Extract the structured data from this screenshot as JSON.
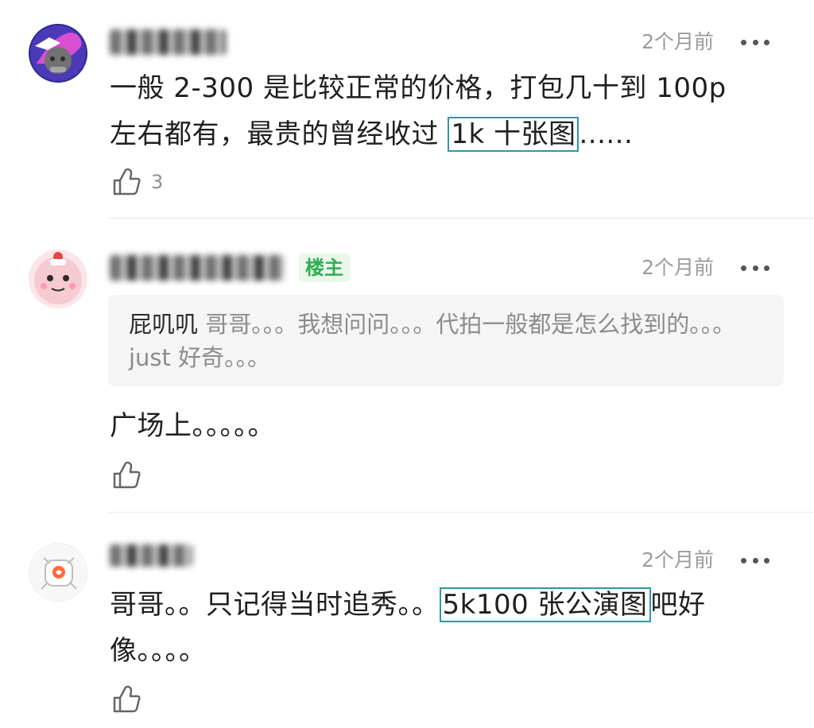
{
  "comments": [
    {
      "time": "2个月前",
      "text_before": "一般 2-300 是比较正常的价格，打包几十到 100p 左右都有，最贵的曾经收过 ",
      "text_highlight": "1k 十张图",
      "text_after": "......",
      "like_count": "3"
    },
    {
      "badge": "楼主",
      "time": "2个月前",
      "quote_author": "屁叽叽",
      "quote_text": " 哥哥。。。我想问问。。。代拍一般都是怎么找到的。。。just 好奇。。。",
      "text": "广场上。。。。。"
    },
    {
      "time": "2个月前",
      "text_before": "哥哥。。只记得当时追秀。。",
      "text_highlight": "5k100 张公演图",
      "text_after": "吧好像。。。。"
    }
  ],
  "icons": {
    "more": "more-horizontal-icon",
    "like": "thumbs-up-icon"
  },
  "colors": {
    "highlight_border": "#2a9aa3",
    "badge_text": "#2fae50",
    "badge_bg": "#e8f7ea",
    "meta_text": "#9b9b9b"
  }
}
